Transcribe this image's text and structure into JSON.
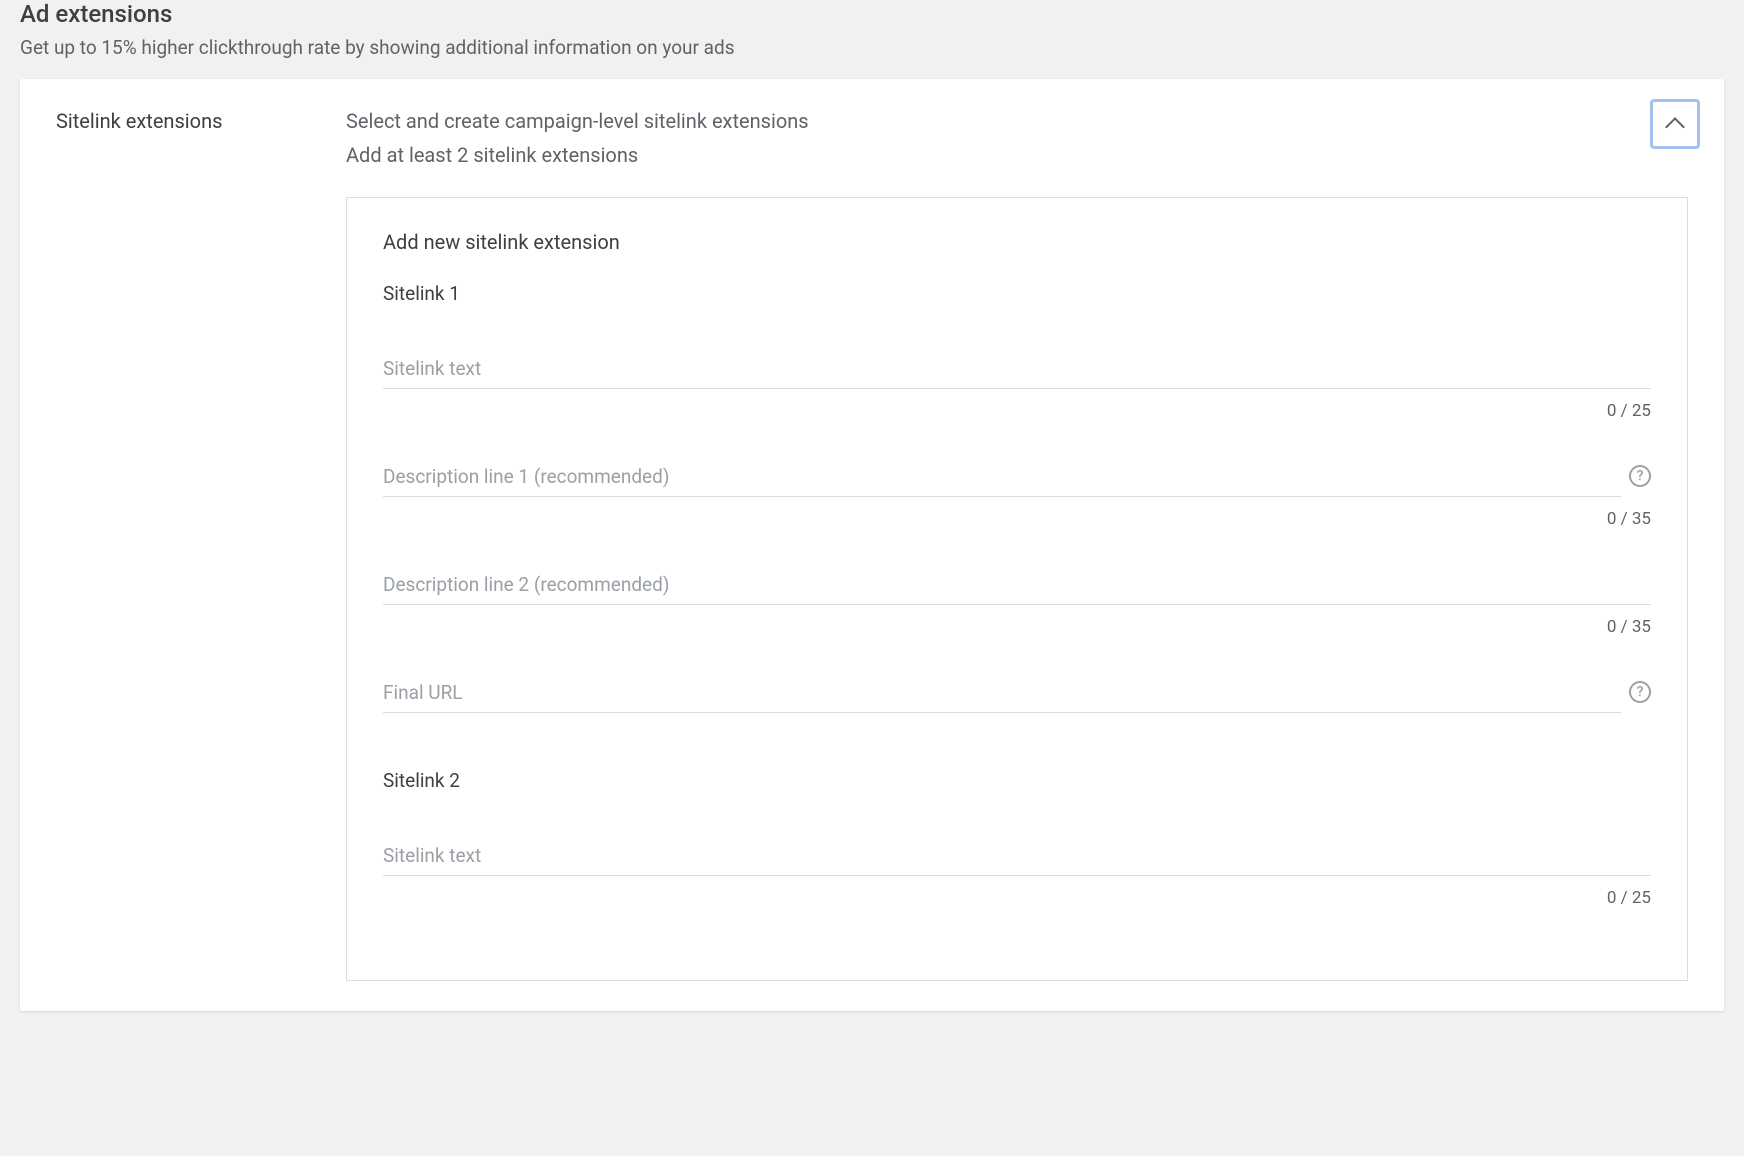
{
  "header": {
    "title": "Ad extensions",
    "subtitle": "Get up to 15% higher clickthrough rate by showing additional information on your ads"
  },
  "section": {
    "label": "Sitelink extensions",
    "heading": "Select and create campaign-level sitelink extensions",
    "subheading": "Add at least 2 sitelink extensions"
  },
  "form": {
    "box_title": "Add new sitelink extension",
    "sitelinks": [
      {
        "title": "Sitelink 1",
        "fields": {
          "text": {
            "placeholder": "Sitelink text",
            "value": "",
            "counter": "0 / 25",
            "help": false
          },
          "desc1": {
            "placeholder": "Description line 1 (recommended)",
            "value": "",
            "counter": "0 / 35",
            "help": true
          },
          "desc2": {
            "placeholder": "Description line 2 (recommended)",
            "value": "",
            "counter": "0 / 35",
            "help": false
          },
          "final_url": {
            "placeholder": "Final URL",
            "value": "",
            "counter": "",
            "help": true
          }
        }
      },
      {
        "title": "Sitelink 2",
        "fields": {
          "text": {
            "placeholder": "Sitelink text",
            "value": "",
            "counter": "0 / 25",
            "help": false
          }
        }
      }
    ]
  },
  "icons": {
    "help": "?"
  }
}
